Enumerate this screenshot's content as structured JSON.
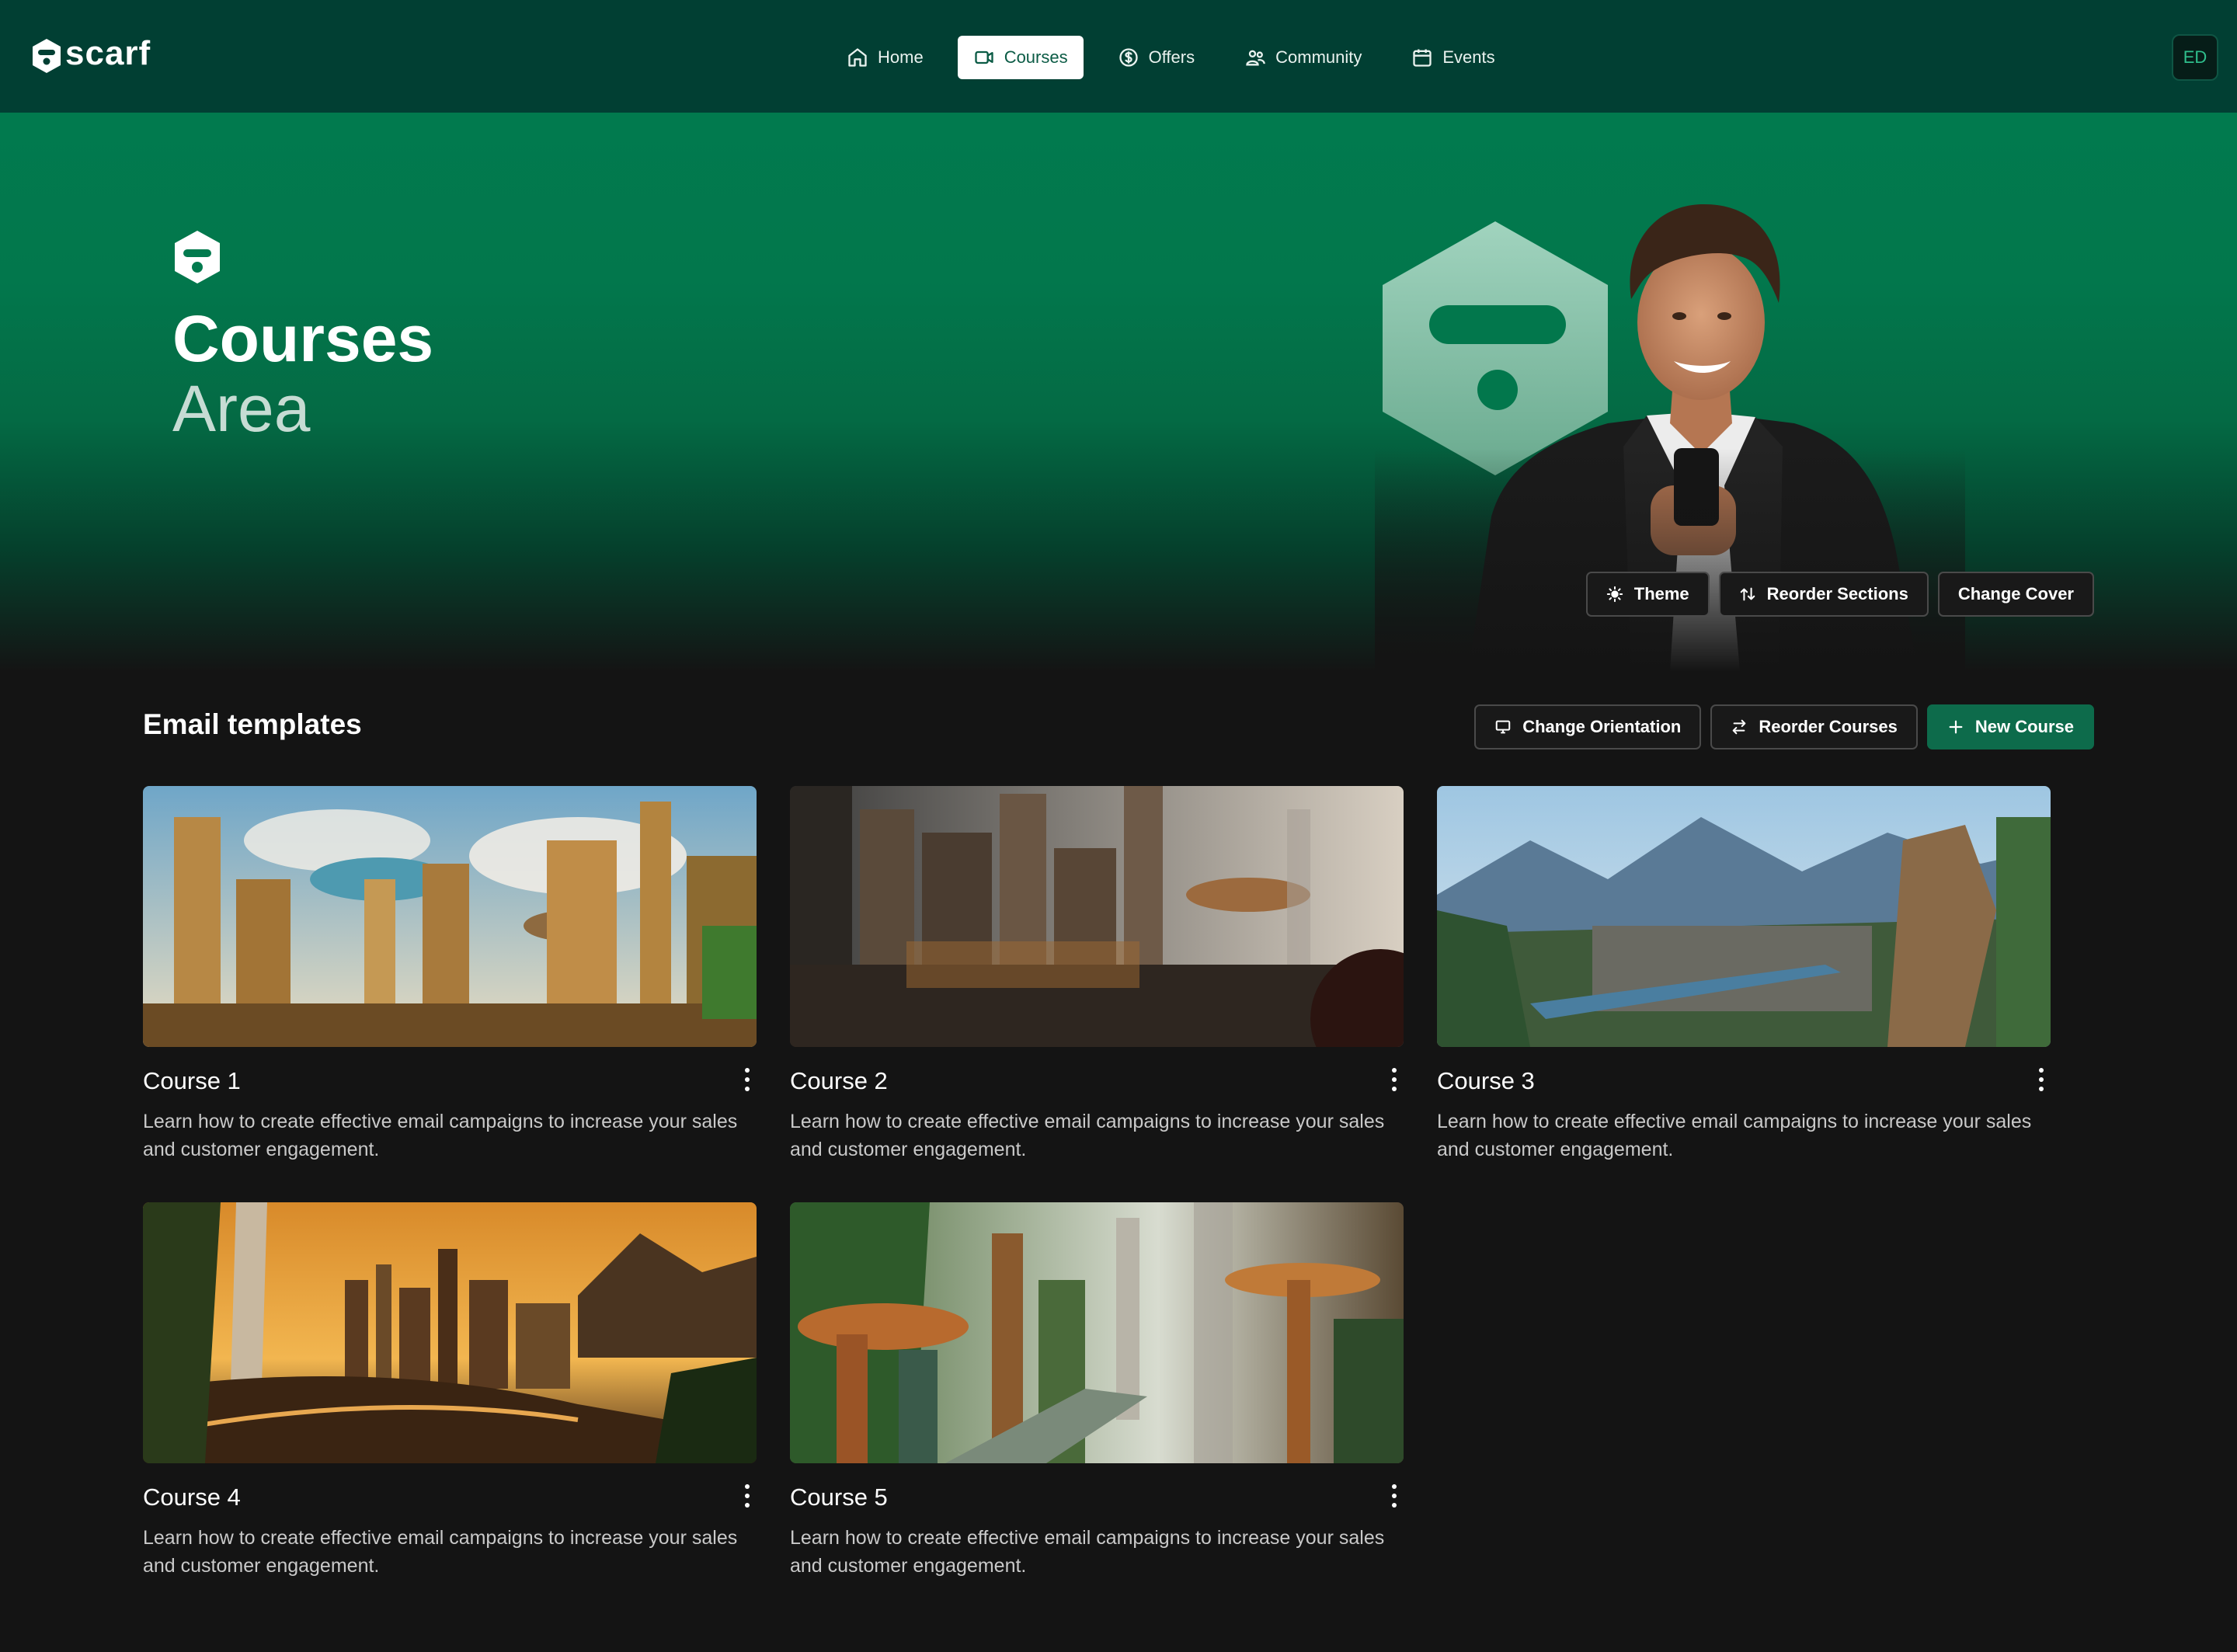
{
  "brand": {
    "name": "scarf"
  },
  "nav": {
    "items": [
      {
        "label": "Home",
        "icon": "home-icon",
        "active": false
      },
      {
        "label": "Courses",
        "icon": "video-icon",
        "active": true
      },
      {
        "label": "Offers",
        "icon": "dollar-circle-icon",
        "active": false
      },
      {
        "label": "Community",
        "icon": "users-icon",
        "active": false
      },
      {
        "label": "Events",
        "icon": "calendar-icon",
        "active": false
      }
    ]
  },
  "user": {
    "initials": "ED"
  },
  "hero": {
    "title": "Courses",
    "subtitle": "Area",
    "actions": {
      "theme": "Theme",
      "reorder_sections": "Reorder Sections",
      "change_cover": "Change Cover"
    }
  },
  "section": {
    "title": "Email templates",
    "actions": {
      "change_orientation": "Change Orientation",
      "reorder_courses": "Reorder Courses",
      "new_course": "New Course"
    }
  },
  "courses": [
    {
      "title": "Course 1",
      "description": "Learn how to create effective email campaigns to increase your sales and customer engagement."
    },
    {
      "title": "Course 2",
      "description": "Learn how to create effective email campaigns to increase your sales and customer engagement."
    },
    {
      "title": "Course 3",
      "description": "Learn how to create effective email campaigns to increase your sales and customer engagement."
    },
    {
      "title": "Course 4",
      "description": "Learn how to create effective email campaigns to increase your sales and customer engagement."
    },
    {
      "title": "Course 5",
      "description": "Learn how to create effective email campaigns to increase your sales and customer engagement."
    }
  ],
  "colors": {
    "nav_bg": "#013f33",
    "hero_green": "#017a4e",
    "primary": "#0d6b4b",
    "page_bg": "#141414"
  }
}
